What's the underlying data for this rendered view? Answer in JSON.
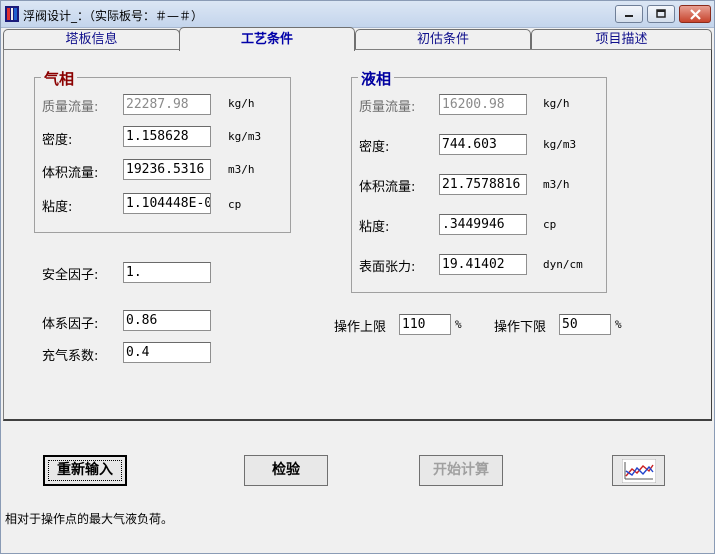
{
  "window": {
    "title": "浮阀设计_：（实际板号：＃—＃）",
    "icon": "app-icon"
  },
  "tabs": [
    {
      "label": "塔板信息",
      "active": false
    },
    {
      "label": "工艺条件",
      "active": true
    },
    {
      "label": "初估条件",
      "active": false
    },
    {
      "label": "项目描述",
      "active": false
    }
  ],
  "gas": {
    "title": "气相",
    "mass_flow": {
      "label": "质量流量:",
      "value": "22287.98",
      "unit": "kg/h"
    },
    "density": {
      "label": "密度:",
      "value": "1.158628",
      "unit": "kg/m3"
    },
    "volume_flow": {
      "label": "体积流量:",
      "value": "19236.5316",
      "unit": "m3/h"
    },
    "viscosity": {
      "label": "粘度:",
      "value": "1.104448E-0",
      "unit": "cp"
    }
  },
  "liquid": {
    "title": "液相",
    "mass_flow": {
      "label": "质量流量:",
      "value": "16200.98",
      "unit": "kg/h"
    },
    "density": {
      "label": "密度:",
      "value": "744.603",
      "unit": "kg/m3"
    },
    "volume_flow": {
      "label": "体积流量:",
      "value": "21.7578816",
      "unit": "m3/h"
    },
    "viscosity": {
      "label": "粘度:",
      "value": ".3449946",
      "unit": "cp"
    },
    "surface_tension": {
      "label": "表面张力:",
      "value": "19.41402",
      "unit": "dyn/cm"
    }
  },
  "factors": {
    "safety": {
      "label": "安全因子:",
      "value": "1."
    },
    "system": {
      "label": "体系因子:",
      "value": "0.86"
    },
    "aeration": {
      "label": "充气系数:",
      "value": "0.4"
    }
  },
  "operation": {
    "upper": {
      "label": "操作上限",
      "value": "110",
      "unit": "%"
    },
    "lower": {
      "label": "操作下限",
      "value": "50",
      "unit": "%"
    }
  },
  "buttons": {
    "reset": "重新输入",
    "check": "检验",
    "calculate": "开始计算",
    "chart_icon": "chart-icon"
  },
  "status_text": "相对于操作点的最大气液负荷。"
}
